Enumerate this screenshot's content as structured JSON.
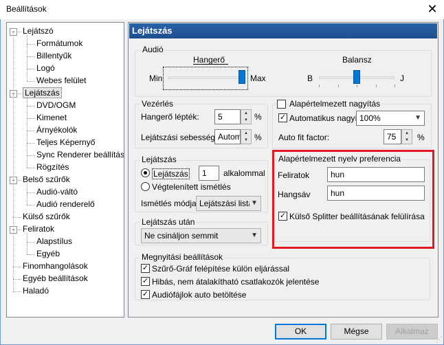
{
  "window": {
    "title": "Beállítások",
    "close_glyph": "✕"
  },
  "tree": {
    "items": [
      {
        "label": "Lejátszó",
        "level": 0,
        "expander": "−"
      },
      {
        "label": "Formátumok",
        "level": 1
      },
      {
        "label": "Billentyűk",
        "level": 1
      },
      {
        "label": "Logó",
        "level": 1
      },
      {
        "label": "Webes felület",
        "level": 1
      },
      {
        "label": "Lejátszás",
        "level": 0,
        "expander": "−",
        "selected": true
      },
      {
        "label": "DVD/OGM",
        "level": 1
      },
      {
        "label": "Kimenet",
        "level": 1
      },
      {
        "label": "Árnyékolók",
        "level": 1
      },
      {
        "label": "Teljes Képernyő",
        "level": 1
      },
      {
        "label": "Sync Renderer beállítások",
        "level": 1
      },
      {
        "label": "Rögzítés",
        "level": 1
      },
      {
        "label": "Belső szűrők",
        "level": 0,
        "expander": "−"
      },
      {
        "label": "Audió-váltó",
        "level": 1
      },
      {
        "label": "Audió renderelő",
        "level": 1
      },
      {
        "label": "Külső szűrők",
        "level": 0
      },
      {
        "label": "Feliratok",
        "level": 0,
        "expander": "−"
      },
      {
        "label": "Alapstílus",
        "level": 1
      },
      {
        "label": "Egyéb",
        "level": 1
      },
      {
        "label": "Finomhangolások",
        "level": 0
      },
      {
        "label": "Egyéb beállítások",
        "level": 0
      },
      {
        "label": "Haladó",
        "level": 0
      }
    ]
  },
  "section_title": "Lejátszás",
  "audio": {
    "group_label": "Audió",
    "volume_label": "Hangerő",
    "min": "Min",
    "max": "Max",
    "volume_value": 1.0,
    "balance_label": "Balansz",
    "b": "B",
    "j": "J",
    "balance_value": 0.5
  },
  "control": {
    "group_label": "Vezérlés",
    "volume_step_label": "Hangerő lépték:",
    "volume_step_value": "5",
    "volume_step_unit": "%",
    "speed_step_label": "Lejátszási sebesség",
    "speed_step_value": "Automatikus",
    "speed_step_unit": "%"
  },
  "zoom": {
    "group_label": "Alapértelmezett nagyítás",
    "auto_zoom_label": "Automatikus nagyítás",
    "auto_zoom_checked": true,
    "auto_zoom_value": "100%",
    "auto_fit_label": "Auto fit factor:",
    "auto_fit_value": "75",
    "auto_fit_unit": "%"
  },
  "playback": {
    "group_label": "Lejátszás",
    "play_label": "Lejátszás",
    "play_count": "1",
    "play_count_unit": "alkalommal",
    "repeat_forever_label": "Végtelenített ismétlés",
    "repeat_mode_label": "Ismétlés módja",
    "repeat_mode_value": "Lejátszási lista"
  },
  "lang": {
    "group_label": "Alapértelmezett nyelv preferencia",
    "subtitles_label": "Feliratok",
    "subtitles_value": "hun",
    "audio_track_label": "Hangsáv",
    "audio_track_value": "hun",
    "override_label": "Külső Splitter beállításának felülírása",
    "override_checked": true
  },
  "after": {
    "group_label": "Lejátszás után",
    "value": "Ne csináljon semmit"
  },
  "open": {
    "group_label": "Megnyitási beállítások",
    "items": [
      {
        "label": "Szűrő-Gráf felépítése külön eljárással",
        "checked": true
      },
      {
        "label": "Hibás, nem átalakítható csatlakozók jelentése",
        "checked": true
      },
      {
        "label": "Audiófájlok auto betöltése",
        "checked": true
      }
    ]
  },
  "buttons": {
    "ok": "OK",
    "cancel": "Mégse",
    "apply": "Alkalmaz"
  },
  "glyphs": {
    "check": "✓",
    "dropdown": "▼",
    "up": "▲",
    "down": "▼"
  },
  "colors": {
    "header_blue": "#1e4f8f",
    "highlight_red": "#e01922",
    "slider_thumb": "#0078d7"
  }
}
